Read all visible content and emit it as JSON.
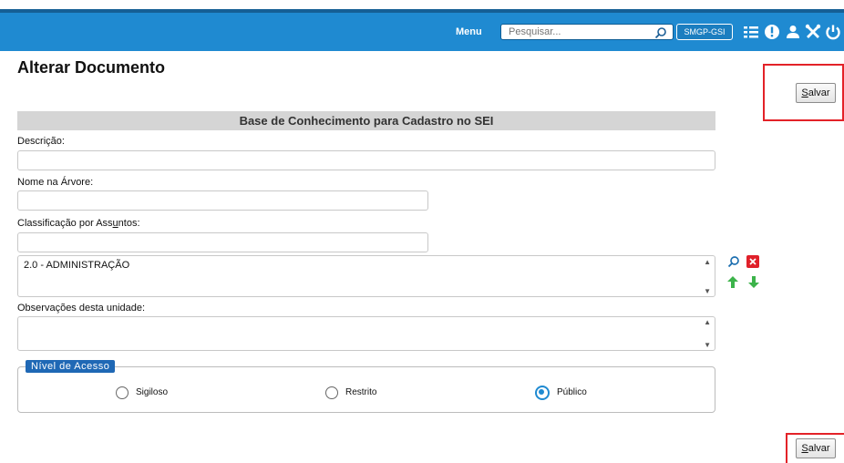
{
  "header": {
    "menu_label": "Menu",
    "search_placeholder": "Pesquisar...",
    "unit": "SMGP-GSI",
    "icons": [
      "list-icon",
      "alert-icon",
      "user-icon",
      "tools-icon",
      "power-icon"
    ]
  },
  "page": {
    "title": "Alterar Documento",
    "save_label_first": "S",
    "save_label_rest": "alvar"
  },
  "form": {
    "section_title": "Base de Conhecimento para Cadastro no SEI",
    "descricao_label": "Descrição:",
    "descricao_value": "",
    "arvore_label": "Nome na Árvore:",
    "arvore_value": "",
    "classificacao_label_pre": "Classificação por Ass",
    "classificacao_label_u": "u",
    "classificacao_label_post": "ntos:",
    "classificacao_value": "",
    "assuntos": [
      "2.0 - ADMINISTRAÇÃO"
    ],
    "observacoes_label": "Observações desta unidade:",
    "observacoes_value": ""
  },
  "access": {
    "legend": "Nível de Acesso",
    "options": [
      {
        "label": "Sigiloso",
        "checked": false
      },
      {
        "label": "Restrito",
        "checked": false
      },
      {
        "label": "Público",
        "checked": true
      }
    ]
  },
  "colors": {
    "header_blue": "#1f8ad1",
    "highlight_red": "#e32228",
    "remove_red": "#e0202a",
    "arrow_green": "#3cb34a"
  }
}
